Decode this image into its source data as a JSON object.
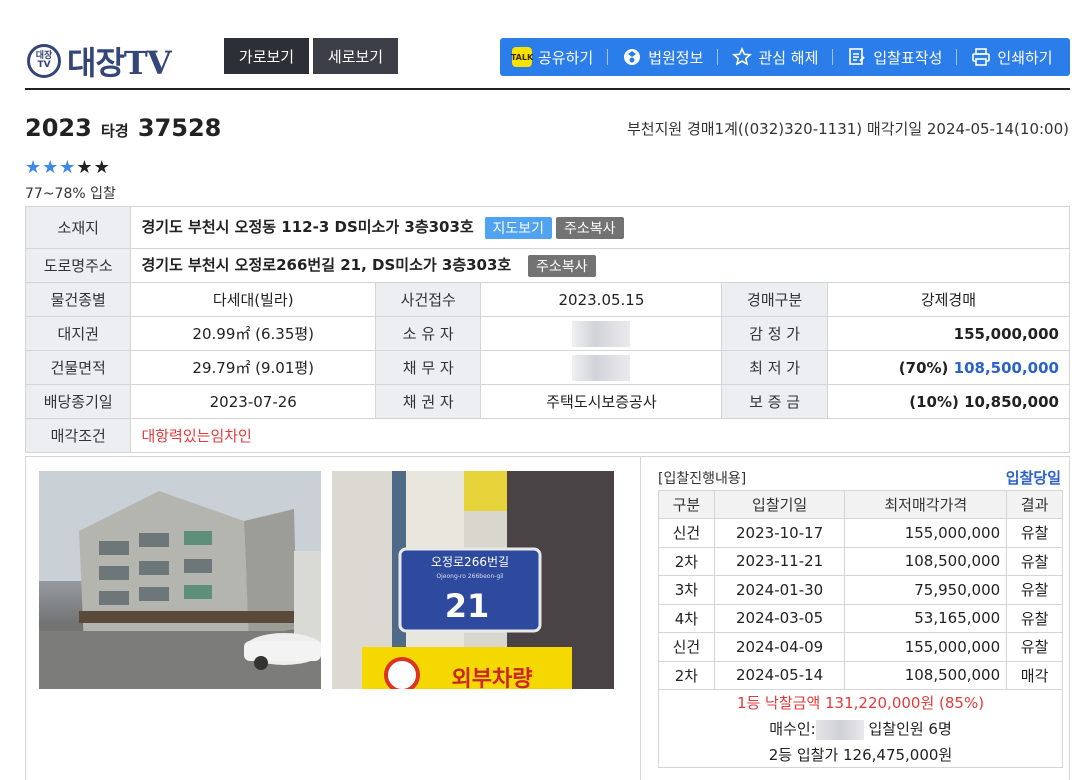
{
  "brand": {
    "logo_mark": "대장TV",
    "logo_text": "대장TV"
  },
  "view_buttons": {
    "horizontal": "가로보기",
    "vertical": "세로보기"
  },
  "toolbar": {
    "talk_icon_label": "TALK",
    "share": "공유하기",
    "court_info": "법원정보",
    "unwatch": "관심 해제",
    "bid_form": "입찰표작성",
    "print": "인쇄하기"
  },
  "case": {
    "year": "2023",
    "type": "타경",
    "number": "37528"
  },
  "court_line": "부천지원 경매1계((032)320-1131) 매각기일 2024-05-14(10:00)",
  "rating": {
    "stars": 3,
    "max": 5,
    "rate_text": "77~78% 입찰"
  },
  "info": {
    "location_label": "소재지",
    "location": "경기도 부천시 오정동 112-3 DS미소가 3층303호",
    "map_btn": "지도보기",
    "copy_btn": "주소복사",
    "road_label": "도로명주소",
    "road": "경기도 부천시 오정로266번길 21, DS미소가 3층303호",
    "copy_btn2": "주소복사",
    "type_label": "물건종별",
    "type": "다세대(빌라)",
    "receipt_label": "사건접수",
    "receipt": "2023.05.15",
    "auction_kind_label": "경매구분",
    "auction_kind": "강제경매",
    "land_label": "대지권",
    "land": "20.99㎡ (6.35평)",
    "owner_label": "소 유 자",
    "appraisal_label": "감 정 가",
    "appraisal": "155,000,000",
    "building_label": "건물면적",
    "building": "29.79㎡ (9.01평)",
    "debtor_label": "채 무 자",
    "min_label": "최 저 가",
    "min_pct": "(70%)",
    "min_price": "108,500,000",
    "deadline_label": "배당종기일",
    "deadline": "2023-07-26",
    "creditor_label": "채 권 자",
    "creditor": "주택도시보증공사",
    "deposit_label": "보 증 금",
    "deposit": "(10%) 10,850,000",
    "condition_label": "매각조건",
    "condition": "대항력있는임차인"
  },
  "photo2": {
    "sign_ko": "오정로266번길",
    "sign_en": "Ojeong-ro 266beon-gil",
    "sign_no": "21",
    "banner": "외부차량"
  },
  "bids": {
    "title": "[입찰진행내용]",
    "today": "입찰당일",
    "headers": [
      "구분",
      "입찰기일",
      "최저매각가격",
      "결과"
    ],
    "rows": [
      {
        "round": "신건",
        "date": "2023-10-17",
        "price": "155,000,000",
        "result": "유찰",
        "highlight": false
      },
      {
        "round": "2차",
        "date": "2023-11-21",
        "price": "108,500,000",
        "result": "유찰",
        "highlight": false
      },
      {
        "round": "3차",
        "date": "2024-01-30",
        "price": "75,950,000",
        "result": "유찰",
        "highlight": false
      },
      {
        "round": "4차",
        "date": "2024-03-05",
        "price": "53,165,000",
        "result": "유찰",
        "highlight": false
      },
      {
        "round": "신건",
        "date": "2024-04-09",
        "price": "155,000,000",
        "result": "유찰",
        "highlight": false
      },
      {
        "round": "2차",
        "date": "2024-05-14",
        "price": "108,500,000",
        "result": "매각",
        "highlight": true
      }
    ],
    "winning": "1등 낙찰금액 131,220,000원 (85%)",
    "buyer_label": "매수인:",
    "bidders": "입찰인원 6명",
    "second": "2등 입찰가 126,475,000원"
  },
  "colors": {
    "accent": "#2b7de9",
    "navy": "#34457a",
    "red": "#e23b3b",
    "blue_text": "#2b62c9"
  }
}
